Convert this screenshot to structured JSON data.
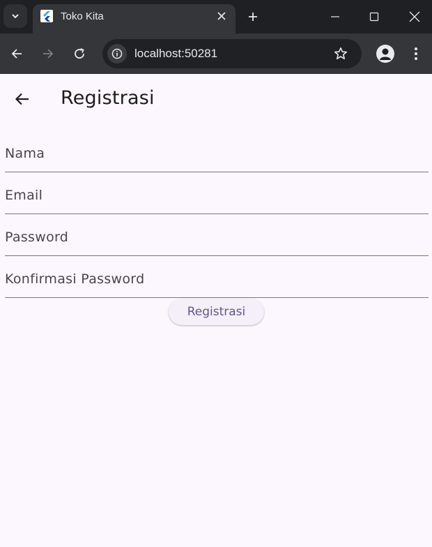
{
  "browser": {
    "tab_title": "Toko Kita",
    "url": "localhost:50281"
  },
  "appbar": {
    "title": "Registrasi"
  },
  "form": {
    "fields": [
      {
        "label": "Nama"
      },
      {
        "label": "Email"
      },
      {
        "label": "Password"
      },
      {
        "label": "Konfirmasi Password"
      }
    ],
    "submit_label": "Registrasi"
  },
  "colors": {
    "background": "#fcf7fe",
    "accent": "#65558f",
    "underline": "#79747e"
  }
}
